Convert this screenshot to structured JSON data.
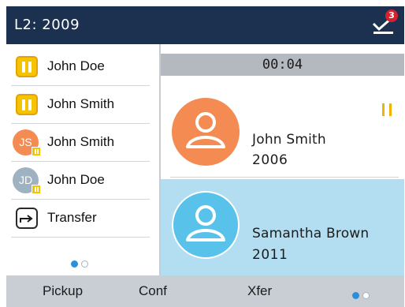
{
  "header": {
    "title": "L2: 2009",
    "voicemail_icon": "voicemail-icon",
    "voicemail_count": "3"
  },
  "colors": {
    "header_bg": "#1c3050",
    "hold": "#f6c300",
    "selected_row": "#b3def2",
    "orange_avatar": "#f38b52",
    "blue_avatar": "#59c2ea",
    "grey_avatar": "#9eb2c2",
    "badge": "#d8202f",
    "page_dot_active": "#2b8fd9"
  },
  "sidebar": {
    "items": [
      {
        "label": "John Doe",
        "icon": "hold-icon"
      },
      {
        "label": "John Smith",
        "icon": "hold-icon"
      },
      {
        "label": "John Smith",
        "initials": "JS",
        "icon": "avatar-on-hold"
      },
      {
        "label": "John Doe",
        "initials": "JD",
        "icon": "avatar-on-hold"
      },
      {
        "label": "Transfer",
        "icon": "transfer-icon"
      }
    ],
    "page": {
      "current": 1,
      "total": 2
    }
  },
  "main": {
    "timer": "00:04",
    "calls": [
      {
        "name": "John Smith",
        "number": "2006",
        "status_icon": "hold-icon"
      },
      {
        "name": "Samantha Brown",
        "number": "2011",
        "selected": true
      }
    ]
  },
  "softkeys": {
    "items": [
      "Pickup",
      "Conf",
      "Xfer"
    ],
    "page": {
      "current": 1,
      "total": 2
    }
  }
}
